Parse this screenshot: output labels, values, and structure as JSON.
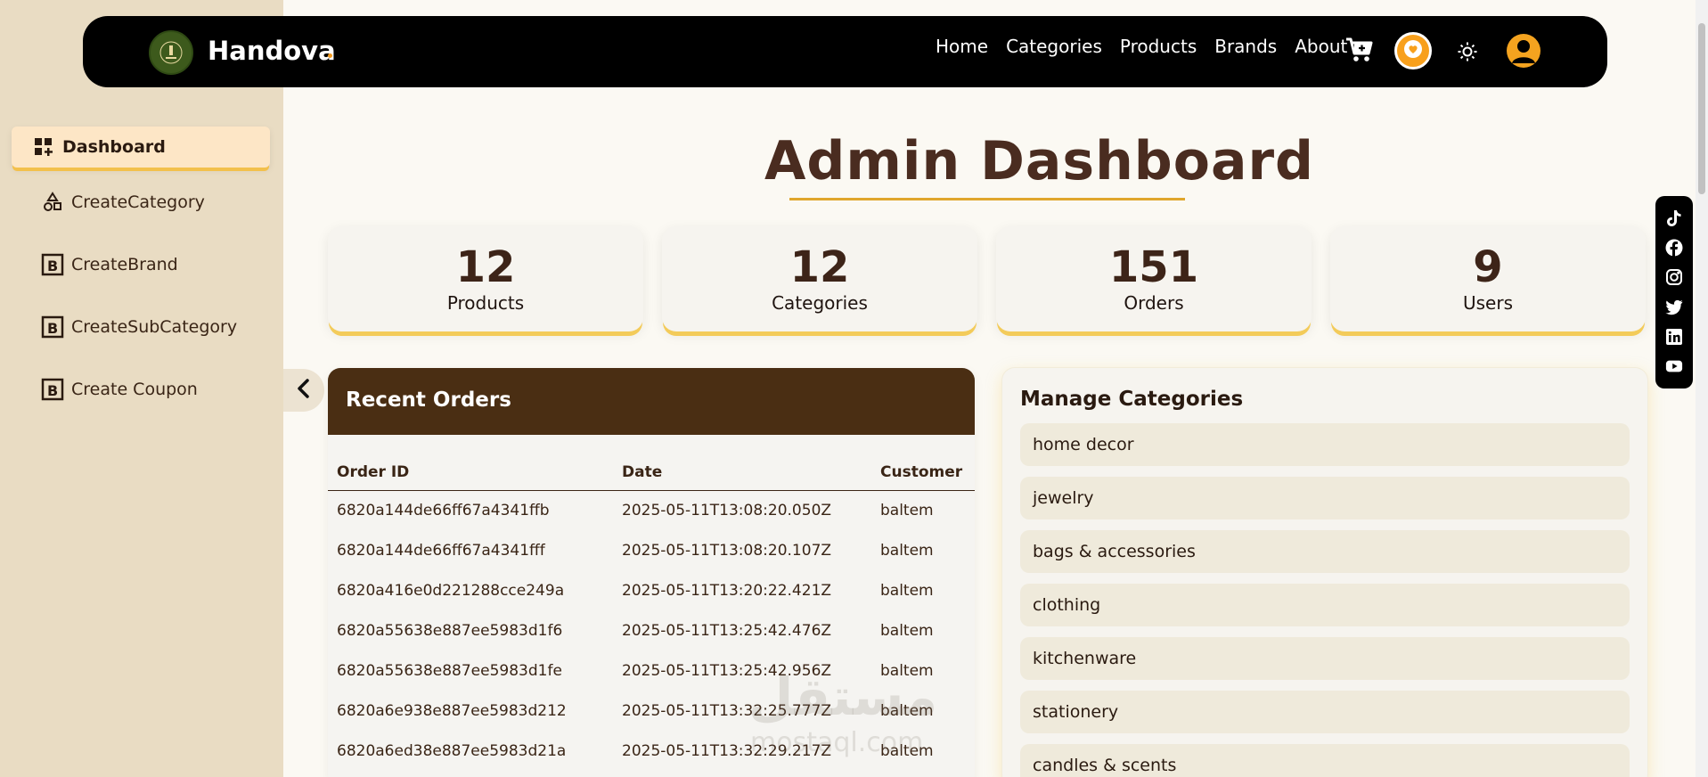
{
  "navbar": {
    "brand": "Handova",
    "links": [
      "Home",
      "Categories",
      "Products",
      "Brands",
      "About"
    ]
  },
  "sidebar": {
    "items": [
      {
        "label": "Dashboard",
        "icon": "dashboard-add-icon"
      },
      {
        "label": "CreateCategory",
        "icon": "shapes-icon"
      },
      {
        "label": "CreateBrand",
        "icon": "brand-b-icon"
      },
      {
        "label": "CreateSubCategory",
        "icon": "brand-b-icon"
      },
      {
        "label": "Create Coupon",
        "icon": "brand-b-icon"
      }
    ]
  },
  "page": {
    "title": "Admin Dashboard"
  },
  "stats": [
    {
      "value": "12",
      "label": "Products"
    },
    {
      "value": "12",
      "label": "Categories"
    },
    {
      "value": "151",
      "label": "Orders"
    },
    {
      "value": "9",
      "label": "Users"
    }
  ],
  "orders": {
    "title": "Recent Orders",
    "columns": [
      "Order ID",
      "Date",
      "Customer"
    ],
    "rows": [
      [
        "6820a144de66ff67a4341ffb",
        "2025-05-11T13:08:20.050Z",
        "baltem"
      ],
      [
        "6820a144de66ff67a4341fff",
        "2025-05-11T13:08:20.107Z",
        "baltem"
      ],
      [
        "6820a416e0d221288cce249a",
        "2025-05-11T13:20:22.421Z",
        "baltem"
      ],
      [
        "6820a55638e887ee5983d1f6",
        "2025-05-11T13:25:42.476Z",
        "baltem"
      ],
      [
        "6820a55638e887ee5983d1fe",
        "2025-05-11T13:25:42.956Z",
        "baltem"
      ],
      [
        "6820a6e938e887ee5983d212",
        "2025-05-11T13:32:25.777Z",
        "baltem"
      ],
      [
        "6820a6ed38e887ee5983d21a",
        "2025-05-11T13:32:29.217Z",
        "baltem"
      ]
    ]
  },
  "categories": {
    "title": "Manage Categories",
    "items": [
      "home decor",
      "jewelry",
      "bags & accessories",
      "clothing",
      "kitchenware",
      "stationery",
      "candles & scents"
    ]
  },
  "watermark": {
    "arabic": "مستقل",
    "latin": "mostaql.com"
  },
  "colors": {
    "sidebar_bg": "#e9dcc3",
    "navbar_bg": "#000000",
    "accent": "#f3c04c",
    "orders_header": "#4a2e13"
  }
}
